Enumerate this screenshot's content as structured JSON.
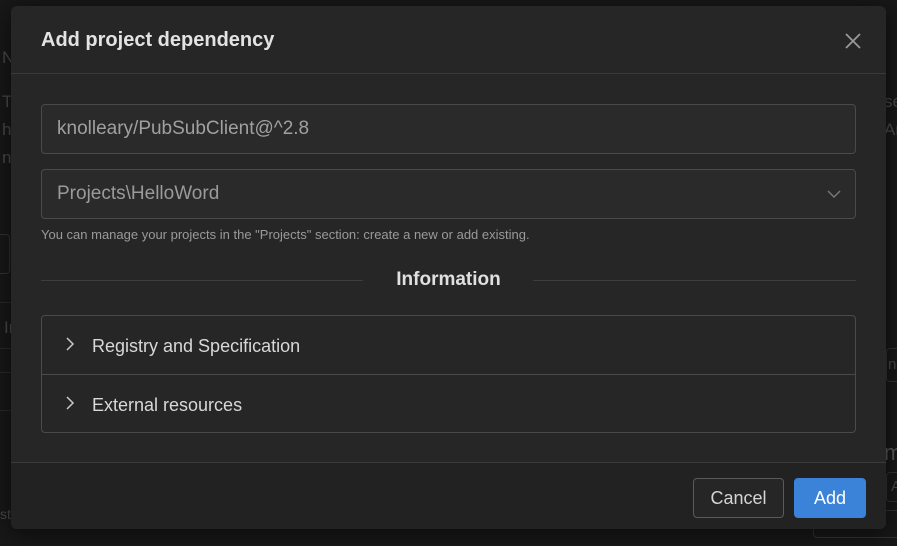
{
  "background": {
    "fragments_left": [
      "N",
      "T",
      "h",
      "n",
      "Ir",
      "st"
    ],
    "fragments_right": [
      "se",
      "Ar",
      "ne",
      "m",
      "A"
    ]
  },
  "dialog": {
    "title": "Add project dependency",
    "close_icon": "close-icon",
    "package_field": {
      "value": "knolleary/PubSubClient@^2.8",
      "placeholder": ""
    },
    "project_select": {
      "selected": "Projects\\HelloWord"
    },
    "hint": "You can manage your projects in the \"Projects\" section: create a new or add existing.",
    "section_title": "Information",
    "accordion": [
      {
        "label": "Registry and Specification",
        "expanded": false
      },
      {
        "label": "External resources",
        "expanded": false
      }
    ],
    "buttons": {
      "cancel": "Cancel",
      "add": "Add"
    }
  },
  "colors": {
    "accent": "#3b82d9",
    "modal_bg": "#262626",
    "page_bg": "#181818"
  }
}
